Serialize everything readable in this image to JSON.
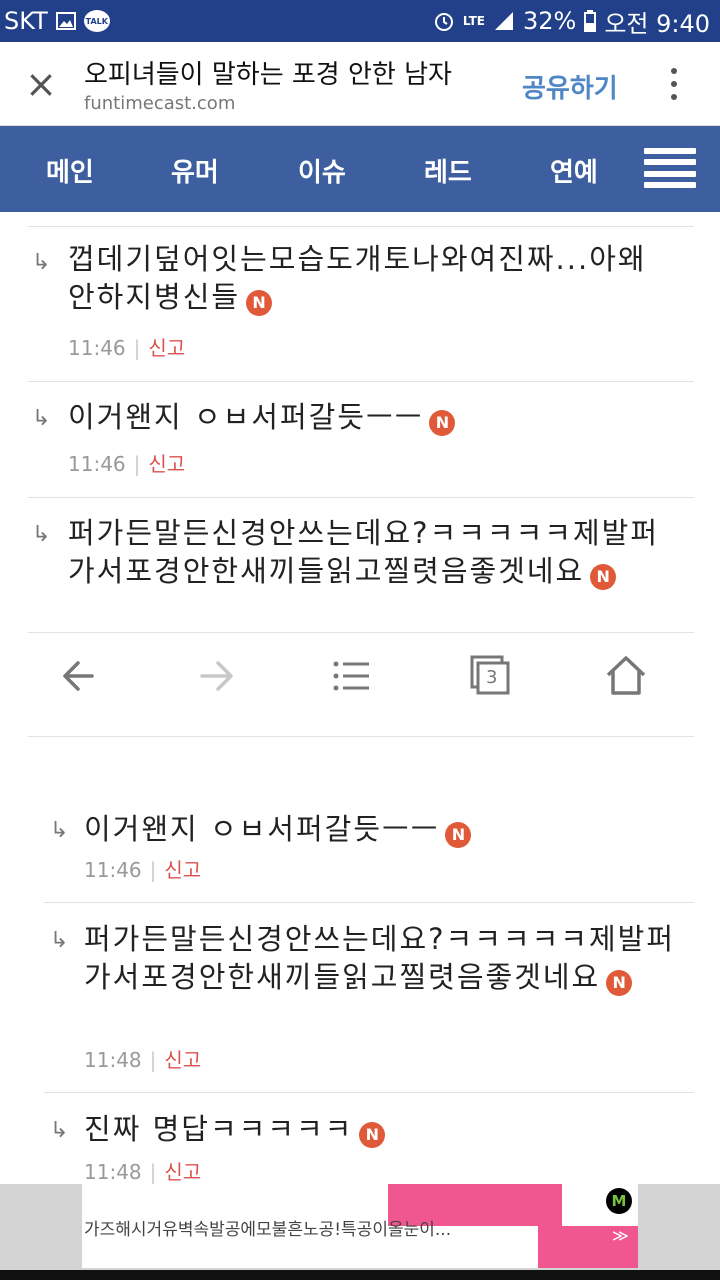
{
  "status_bar": {
    "carrier": "SKT",
    "network": "LTE",
    "battery": "32%",
    "time": "오전 9:40",
    "talk_label": "TALK",
    "icons": [
      "image-icon",
      "talk-icon",
      "alarm-icon",
      "lte-icon",
      "signal-icon",
      "battery-icon"
    ]
  },
  "app_bar": {
    "title": "오피녀들이 말하는 포경 안한 남자",
    "domain": "funtimecast.com",
    "share_label": "공유하기",
    "close_glyph": "×"
  },
  "nav": {
    "items": [
      "메인",
      "유머",
      "이슈",
      "레드",
      "연예"
    ]
  },
  "comments_top": [
    {
      "arrow": "↳",
      "text": "껍데기덮어잇는모습도개토나와여진짜...아왜안하지병신들",
      "badge": "N",
      "time": "11:46",
      "report": "신고"
    },
    {
      "arrow": "↳",
      "text": "이거왠지 ㅇㅂ서퍼갈듯ㅡㅡ",
      "badge": "N",
      "time": "11:46",
      "report": "신고"
    },
    {
      "arrow": "↳",
      "text": "퍼가든말든신경안쓰는데요?ㅋㅋㅋㅋㅋ제발퍼가서포경안한새끼들읽고찔렷음좋겟네요",
      "badge": "N"
    }
  ],
  "comments_bottom": [
    {
      "arrow": "↳",
      "text": "이거왠지 ㅇㅂ서퍼갈듯ㅡㅡ",
      "badge": "N",
      "time": "11:46",
      "report": "신고"
    },
    {
      "arrow": "↳",
      "text": "퍼가든말든신경안쓰는데요?ㅋㅋㅋㅋㅋ제발퍼가서포경안한새끼들읽고찔렷음좋겟네요",
      "badge": "N",
      "time": "11:48",
      "report": "신고"
    },
    {
      "arrow": "↳",
      "text": "진짜 명답ㅋㅋㅋㅋㅋ",
      "badge": "N",
      "time": "11:48",
      "report": "신고"
    }
  ],
  "toolbar": {
    "tab_count": "3",
    "icons": [
      "back-arrow-icon",
      "forward-arrow-icon",
      "list-icon",
      "tabs-icon",
      "home-icon"
    ]
  },
  "ad": {
    "text": "가즈해시거유벽속발공에모불흔노공!특공이올눈이...",
    "logo": "M",
    "arrows": "≫"
  },
  "colors": {
    "status_bar": "#22408a",
    "nav_bar": "#3d5fa0",
    "share": "#4f86c6",
    "badge": "#e05a3a",
    "report": "#d9534f",
    "ad_pink": "#f0568f"
  }
}
